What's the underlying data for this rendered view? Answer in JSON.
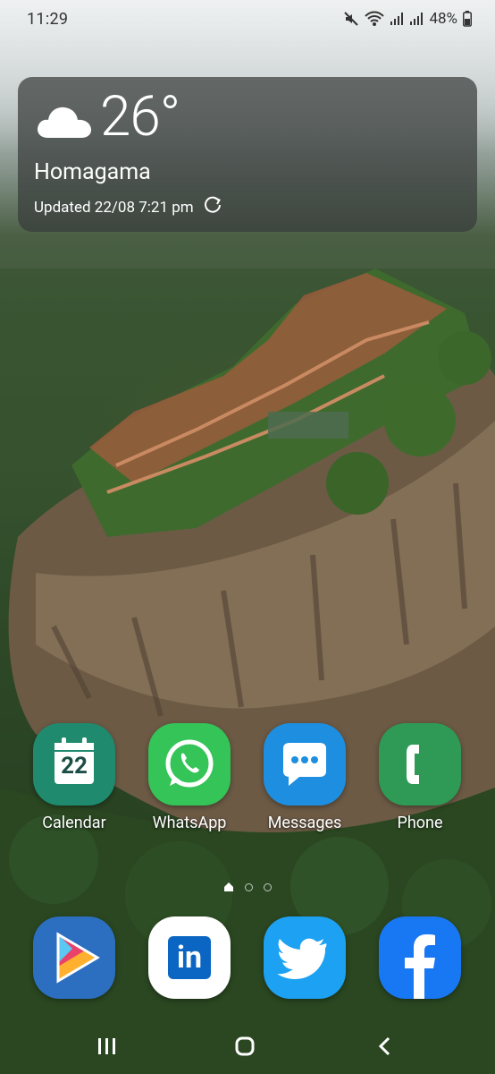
{
  "status_bar": {
    "time": "11:29",
    "battery_percent": "48%",
    "icons": [
      "mute-icon",
      "wifi-icon",
      "signal-icon",
      "signal-icon",
      "battery-icon"
    ]
  },
  "weather": {
    "temperature": "26°",
    "condition_icon": "cloud-icon",
    "location": "Homagama",
    "updated": "Updated 22/08 7:21 pm"
  },
  "apps": [
    {
      "label": "Calendar",
      "icon": "calendar-icon",
      "badge_text": "22",
      "color": "#1f8a6e"
    },
    {
      "label": "WhatsApp",
      "icon": "whatsapp-icon",
      "color": "#34c457"
    },
    {
      "label": "Messages",
      "icon": "messages-icon",
      "color": "#1e8fe0"
    },
    {
      "label": "Phone",
      "icon": "phone-icon",
      "color": "#2f9a55"
    }
  ],
  "dock": [
    {
      "name": "play-store",
      "icon": "play-icon",
      "color": "#2c6fc0"
    },
    {
      "name": "linkedin",
      "icon": "linkedin-icon",
      "color": "#ffffff",
      "text": "in"
    },
    {
      "name": "twitter",
      "icon": "twitter-icon",
      "color": "#1da1f2"
    },
    {
      "name": "facebook",
      "icon": "facebook-icon",
      "color": "#1877f2"
    }
  ],
  "pager": {
    "pages": 3,
    "current": 1
  },
  "nav": [
    "recents-icon",
    "home-icon",
    "back-icon"
  ]
}
